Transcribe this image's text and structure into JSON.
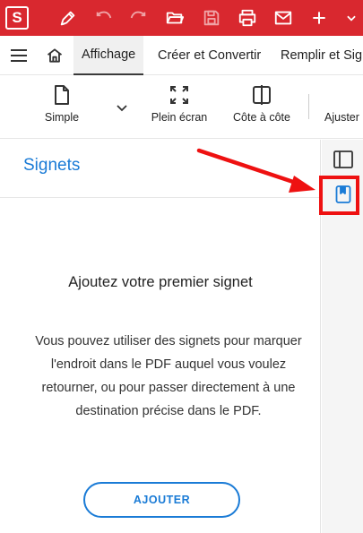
{
  "titlebar": {
    "logo_letter": "S",
    "icons": [
      "pen-icon",
      "undo-icon",
      "redo-icon",
      "folder-icon",
      "save-icon",
      "print-icon",
      "mail-icon",
      "plus-icon",
      "chevron-down-icon"
    ],
    "color": "#d9282f"
  },
  "menu": {
    "tabs": [
      {
        "label": "Affichage"
      },
      {
        "label": "Créer et Convertir"
      },
      {
        "label": "Remplir et Signer"
      }
    ]
  },
  "toolbar": {
    "tools": [
      {
        "label": "Simple"
      },
      {
        "label": "Plein écran"
      },
      {
        "label": "Côte à côte"
      },
      {
        "label": "Ajuster"
      }
    ]
  },
  "panel": {
    "title": "Signets",
    "empty_title": "Ajoutez votre premier signet",
    "empty_description": "Vous pouvez utiliser des signets pour marquer l'endroit dans le PDF auquel vous voulez retourner, ou pour passer directement à une destination précise dans le PDF.",
    "add_button_label": "AJOUTER",
    "accent": "#1a7bd6"
  },
  "rail": {
    "items": [
      "panel-toggle-icon",
      "bookmark-icon"
    ]
  },
  "annotation": {
    "color": "#ee1111"
  }
}
